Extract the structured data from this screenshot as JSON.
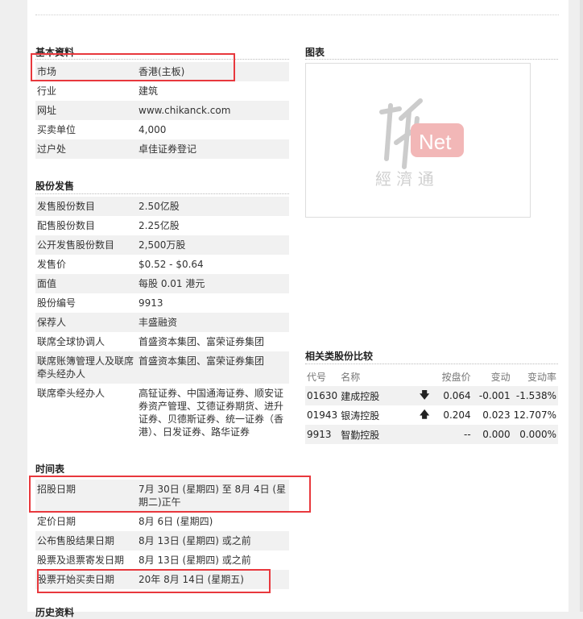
{
  "basic": {
    "title": "基本資料",
    "rows": [
      {
        "k": "市场",
        "v": "香港(主板)"
      },
      {
        "k": "行业",
        "v": "建筑"
      },
      {
        "k": "网址",
        "v": "www.chikanck.com"
      },
      {
        "k": "买卖单位",
        "v": "4,000"
      },
      {
        "k": "过户处",
        "v": "卓佳证券登记"
      }
    ]
  },
  "offer": {
    "title": "股份发售",
    "rows": [
      {
        "k": "发售股份数目",
        "v": "2.50亿股"
      },
      {
        "k": "配售股份数目",
        "v": "2.25亿股"
      },
      {
        "k": "公开发售股份数目",
        "v": "2,500万股"
      },
      {
        "k": "发售价",
        "v": "$0.52 - $0.64"
      },
      {
        "k": "面值",
        "v": "每股 0.01 港元"
      },
      {
        "k": "股份编号",
        "v": "9913"
      },
      {
        "k": "保荐人",
        "v": "丰盛融资"
      },
      {
        "k": "联席全球协调人",
        "v": "首盛资本集团、富荣证券集团"
      },
      {
        "k": "联席账簿管理人及联席牵头经办人",
        "v": "首盛资本集团、富荣证券集团"
      },
      {
        "k": "联席牵头经办人",
        "v": "高钲证券、中国通海证券、顺安证券资产管理、艾德证券期货、进升证券、贝德斯证券、统一证券（香港）、日发证券、路华证券"
      }
    ]
  },
  "timetable": {
    "title": "时间表",
    "rows": [
      {
        "k": "招股日期",
        "v": "7月 30日 (星期四) 至 8月 4日 (星期二)正午"
      },
      {
        "k": "定价日期",
        "v": "8月 6日 (星期四)"
      },
      {
        "k": "公布售股结果日期",
        "v": "8月 13日 (星期四) 或之前"
      },
      {
        "k": "股票及退票寄发日期",
        "v": "8月 13日 (星期四) 或之前"
      },
      {
        "k": "股票开始买卖日期",
        "v": "20年 8月 14日 (星期五)"
      }
    ],
    "next_title": "历史资料"
  },
  "chart": {
    "title": "图表",
    "logo_net": "Net",
    "logo_cn": "經 濟 通"
  },
  "peers": {
    "title": "相关类股份比较",
    "headers": [
      "代号",
      "名称",
      "",
      "按盘价",
      "变动",
      "变动率"
    ],
    "rows": [
      {
        "code": "01630",
        "name": "建成控股",
        "dir": "down",
        "arrow": "🡇",
        "price": "0.064",
        "chg": "-0.001",
        "pct": "-1.538%"
      },
      {
        "code": "01943",
        "name": "银涛控股",
        "dir": "up",
        "arrow": "🡅",
        "price": "0.204",
        "chg": "0.023",
        "pct": "12.707%"
      },
      {
        "code": "9913",
        "name": "智勤控股",
        "dir": "",
        "arrow": "",
        "price": "--",
        "chg": "0.000",
        "pct": "0.000%"
      }
    ]
  },
  "colors": {
    "highlight": "#e8383d",
    "row_alt": "#f1f1f1",
    "down": "#1a9c1a",
    "up": "#d62020"
  }
}
